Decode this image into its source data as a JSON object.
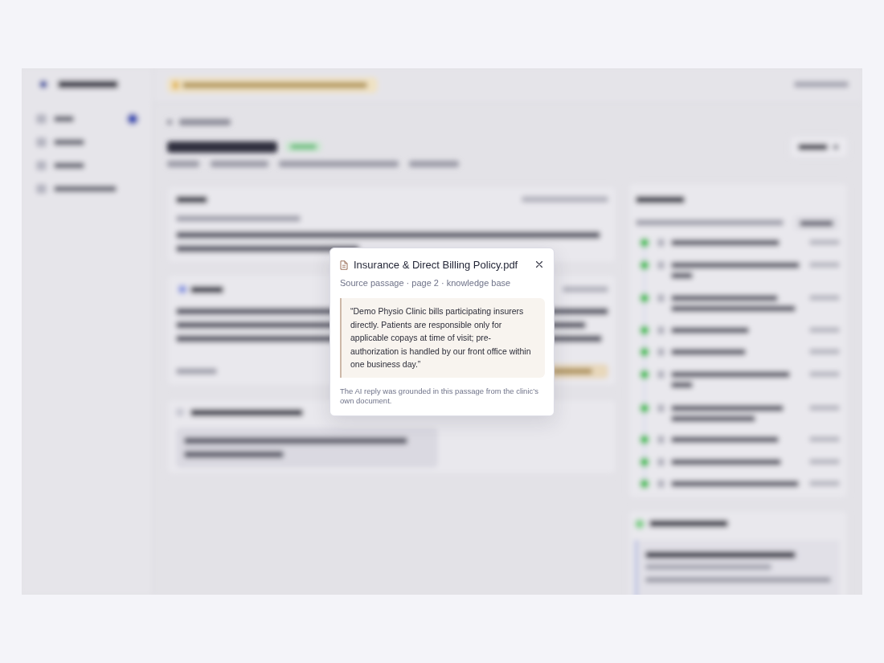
{
  "dialog": {
    "title": "Insurance & Direct Billing Policy.pdf",
    "subtitle": "Source passage · page 2 · knowledge base",
    "passage": "“Demo Physio Clinic bills participating insurers directly. Patients are responsible only for applicable copays at time of visit; pre-authorization is handled by our front office within one business day.”",
    "note": "The AI reply was grounded in this passage from the clinic’s own document."
  }
}
